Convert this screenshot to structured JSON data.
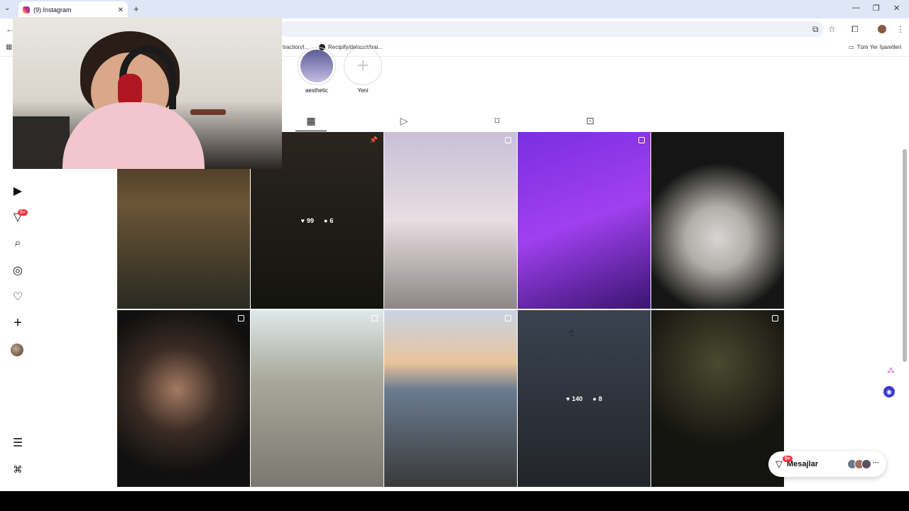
{
  "browser": {
    "tab_title": "(9) Instagram",
    "bookmarks": [
      "traction/l...",
      "Recipify/dataset/trai...",
      "Tüm Yer İşaretleri"
    ]
  },
  "sidebar": {
    "icons": [
      "reels-icon",
      "direct-message-icon",
      "search-icon",
      "explore-icon",
      "heart-icon",
      "create-icon",
      "profile-avatar",
      "menu-icon",
      "threads-icon"
    ],
    "notification_badge": "9+"
  },
  "highlights": [
    {
      "label": "aesthetic"
    },
    {
      "label": "Yeni"
    }
  ],
  "profile_tabs": [
    "posts-grid-icon",
    "reels-tab-icon",
    "saved-bookmark-icon",
    "tagged-icon"
  ],
  "grid": {
    "posts": [
      {
        "hover": false
      },
      {
        "hover": true,
        "likes": "99",
        "comments": "6"
      },
      {
        "hover": false
      },
      {
        "hover": false
      },
      {
        "hover": false
      },
      {
        "hover": false
      },
      {
        "hover": false
      },
      {
        "hover": false
      },
      {
        "hover": true,
        "likes": "140",
        "comments": "8"
      },
      {
        "hover": false
      }
    ]
  },
  "messages": {
    "label": "Mesajlar",
    "badge": "9+"
  },
  "colors": {
    "notification": "#ff3040",
    "tabbar": "#dfe6f5"
  }
}
